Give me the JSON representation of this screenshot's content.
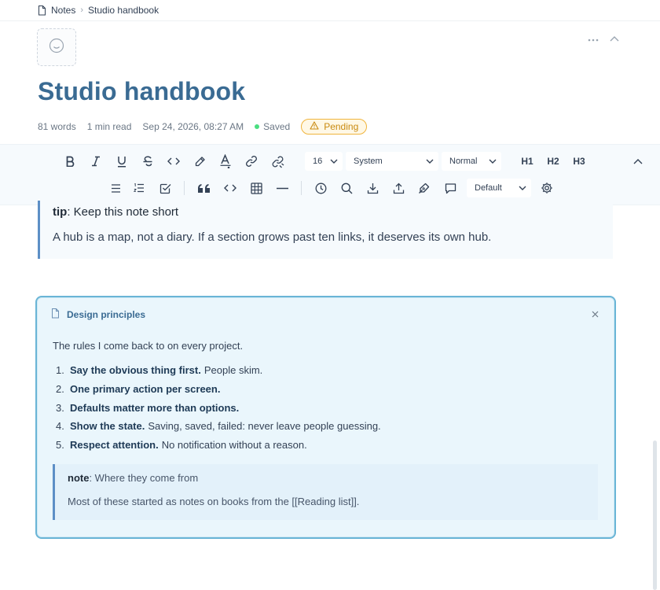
{
  "breadcrumb": {
    "root": "Notes",
    "current": "Studio handbook"
  },
  "note": {
    "title": "Studio handbook",
    "meta": {
      "words": "81 words",
      "read_time": "1 min read",
      "timestamp": "Sep 24, 2026, 08:27 AM",
      "saved": "Saved",
      "pending": "Pending"
    }
  },
  "toolbar": {
    "row1": {
      "font_size": "16",
      "font_family": "System",
      "paragraph_style": "Normal",
      "h1": "H1",
      "h2": "H2",
      "h3": "H3"
    },
    "row2": {
      "theme": "Default"
    }
  },
  "tip_callout": {
    "label": "tip",
    "title": ": Keep this note short",
    "body": "A hub is a map, not a diary. If a section grows past ten links, it deserves its own hub."
  },
  "embed_card": {
    "title": "Design principles",
    "intro": "The rules I come back to on every project.",
    "items": [
      {
        "num": "1.",
        "bold": "Say the obvious thing first.",
        "text": "People skim."
      },
      {
        "num": "2.",
        "bold": "One primary action per screen.",
        "text": ""
      },
      {
        "num": "3.",
        "bold": "Defaults matter more than options.",
        "text": ""
      },
      {
        "num": "4.",
        "bold": "Show the state.",
        "text": "Saving, saved, failed: never leave people guessing."
      },
      {
        "num": "5.",
        "bold": "Respect attention.",
        "text": "No notification without a reason."
      }
    ],
    "note": {
      "label": "note",
      "title": ": Where they come from",
      "body": "Most of these started as notes on books from the [[Reading list]]."
    }
  },
  "colors": {
    "title": "#3a6b93",
    "accent_border": "#6ab5d6",
    "saved_dot": "#4ade80",
    "pending": "#f0b43c"
  }
}
